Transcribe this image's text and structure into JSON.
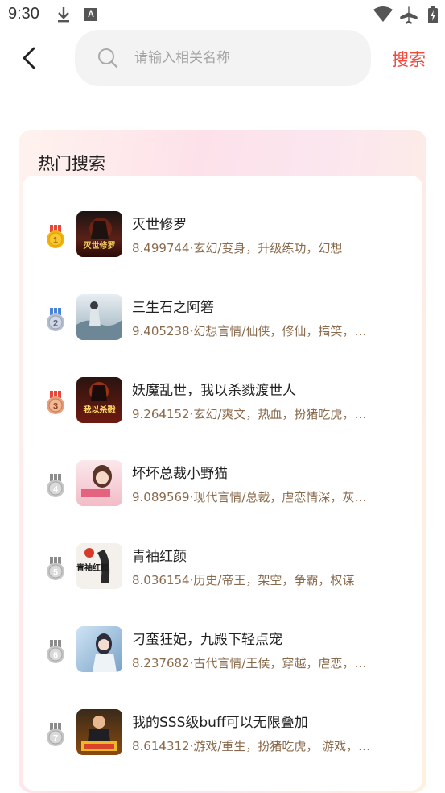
{
  "status_bar": {
    "time": "9:30",
    "indicator_letter": "A"
  },
  "search": {
    "placeholder": "请输入相关名称",
    "button_label": "搜索"
  },
  "hot": {
    "title": "热门搜索",
    "items": [
      {
        "rank": "1",
        "title": "灭世修罗",
        "meta": "8.499744·玄幻/变身，升级练功，幻想",
        "cover_text": "灭世修罗"
      },
      {
        "rank": "2",
        "title": "三生石之阿箬",
        "meta": "9.405238·幻想言情/仙侠，修仙，搞笑，…",
        "cover_text": ""
      },
      {
        "rank": "3",
        "title": "妖魔乱世，我以杀戮渡世人",
        "meta": "9.264152·玄幻/爽文，热血，扮猪吃虎，…",
        "cover_text": "我以杀戮"
      },
      {
        "rank": "4",
        "title": "坏坏总裁小野猫",
        "meta": "9.089569·现代言情/总裁，虐恋情深，灰…",
        "cover_text": ""
      },
      {
        "rank": "5",
        "title": "青袖红颜",
        "meta": "8.036154·历史/帝王，架空，争霸，权谋",
        "cover_text": "青袖红颜"
      },
      {
        "rank": "6",
        "title": "刁蛮狂妃，九殿下轻点宠",
        "meta": "8.237682·古代言情/王侯，穿越，虐恋，…",
        "cover_text": ""
      },
      {
        "rank": "7",
        "title": "我的SSS级buff可以无限叠加",
        "meta": "8.614312·游戏/重生，扮猪吃虎， 游戏，…",
        "cover_text": ""
      }
    ]
  },
  "colors": {
    "accent": "#ee4a3e",
    "meta_text": "#8a6a4c",
    "gold": "#f2b40d",
    "silver": "#b9b9c4",
    "bronze": "#e7a07c"
  }
}
